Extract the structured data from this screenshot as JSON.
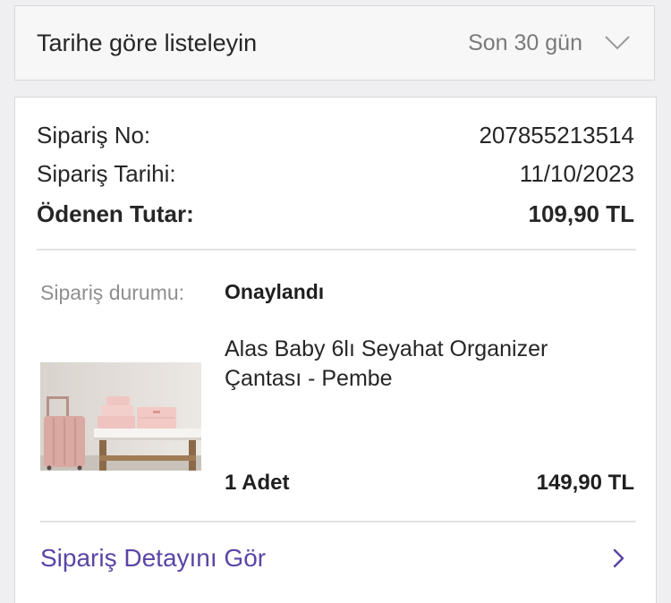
{
  "filter": {
    "title": "Tarihe göre listeleyin",
    "selected_range": "Son 30 gün",
    "icon": "chevron-down-icon"
  },
  "order": {
    "number_label": "Sipariş No:",
    "number_value": "207855213514",
    "date_label": "Sipariş Tarihi:",
    "date_value": "11/10/2023",
    "paid_label": "Ödenen Tutar:",
    "paid_value": "109,90 TL",
    "status_label": "Sipariş durumu:",
    "status_value": "Onaylandı",
    "item": {
      "name": "Alas Baby 6lı Seyahat Organizer Çantası - Pembe",
      "quantity": "1 Adet",
      "price": "149,90 TL"
    },
    "detail_link": "Sipariş Detayını Gör",
    "detail_icon": "chevron-right-icon"
  },
  "colors": {
    "accent": "#5b45a6",
    "page_bg": "#efeff1",
    "card_bg": "#ffffff",
    "muted_text": "#8f8f8f"
  }
}
